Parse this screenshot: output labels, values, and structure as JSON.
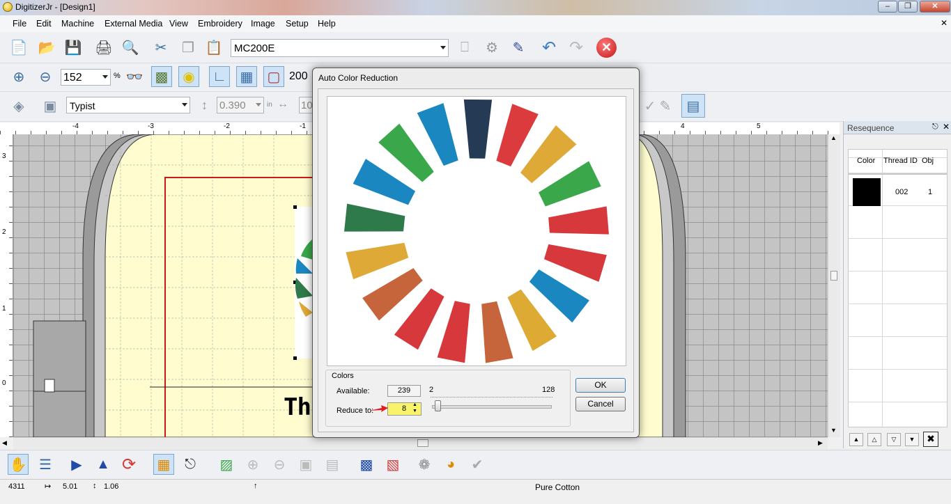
{
  "app": {
    "title": "DigitizerJr - [Design1]"
  },
  "menu": [
    "File",
    "Edit",
    "Machine",
    "External Media",
    "View",
    "Embroidery",
    "Image",
    "Setup",
    "Help"
  ],
  "toolbar": {
    "machine": "MC200E",
    "zoom": "152",
    "zoom_unit": "%",
    "hoop_value": "200"
  },
  "text_toolbar": {
    "font": "Typist",
    "height": "0.390",
    "height_unit": "in",
    "width_value": "10"
  },
  "rulers": {
    "h": [
      "-4",
      "-3",
      "-2",
      "-1",
      "4",
      "5"
    ],
    "v": [
      "3",
      "2",
      "1",
      "0"
    ]
  },
  "canvas_text": "Th",
  "dialog": {
    "title": "Auto Color Reduction",
    "colors_label": "Colors",
    "available_label": "Available:",
    "available_value": "239",
    "reduce_label": "Reduce to:",
    "reduce_value": "8",
    "slider_min": "2",
    "slider_max": "128",
    "slider_level": 8,
    "ok": "OK",
    "cancel": "Cancel",
    "wheel_colors": [
      "#253a55",
      "#db3b3d",
      "#dfa938",
      "#3aa84a",
      "#d7383c",
      "#d7383c",
      "#1b87c1",
      "#ddaa34",
      "#c6643c",
      "#d7383c",
      "#d7383c",
      "#c6643c",
      "#dfa938",
      "#2f7a4a",
      "#1b87c1",
      "#3aa84a",
      "#1b87c1"
    ]
  },
  "resequence": {
    "title": "Resequence",
    "columns": [
      "Color",
      "Thread ID",
      "Obj"
    ],
    "rows": [
      {
        "color": "#000000",
        "thread_id": "002",
        "obj": "1"
      }
    ]
  },
  "status": {
    "stitches": "4311",
    "width": "5.01",
    "height": "1.06",
    "thread": "Pure Cotton"
  }
}
